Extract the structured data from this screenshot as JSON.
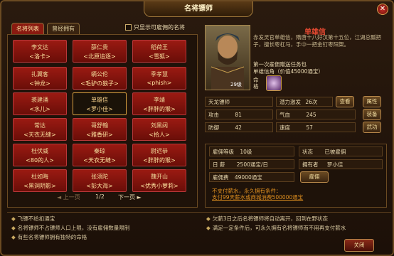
{
  "title": "名将镖师",
  "tabs": [
    "名将列表",
    "曾经拥有"
  ],
  "checkbox_label": "只显示可雇佣的名将",
  "generals": [
    {
      "n1": "李文达",
      "n2": "<洛卡>"
    },
    {
      "n1": "薛仁贵",
      "n2": "<北原追逐>"
    },
    {
      "n1": "稻荷王",
      "n2": "<雪狐>"
    },
    {
      "n1": "扎翼客",
      "n2": "<钟龙>"
    },
    {
      "n1": "辆公伦",
      "n2": "<毛驴の狼子>"
    },
    {
      "n1": "季孝慧",
      "n2": "<phish>"
    },
    {
      "n1": "裘建涌",
      "n2": "<水儿>"
    },
    {
      "n1": "单雄信",
      "n2": "<罗小佳>"
    },
    {
      "n1": "李靖",
      "n2": "<胖胖的猴>"
    },
    {
      "n1": "常达",
      "n2": "<天衣无缝>"
    },
    {
      "n1": "哥舒翰",
      "n2": "<雅香研>"
    },
    {
      "n1": "刘黑闼",
      "n2": "<拾人>"
    },
    {
      "n1": "杜伏威",
      "n2": "<80的人>"
    },
    {
      "n1": "秦琼",
      "n2": "<天衣无缝>"
    },
    {
      "n1": "尉迟恭",
      "n2": "<胖胖的猴>"
    },
    {
      "n1": "杜如晦",
      "n2": "<黑洞阴影>"
    },
    {
      "n1": "张须陀",
      "n2": "<彭大海>"
    },
    {
      "n1": "魏开山",
      "n2": "<优秀小萝莉>"
    }
  ],
  "pager": {
    "prev": "上一页",
    "page": "1/2",
    "next": "下一页"
  },
  "detail": {
    "name": "单雄信",
    "level": "29级",
    "desc": "赤发灵官单雄信，隋唐十八好汉第十五位，江湖总瓢把子，擅长枣杠马，手中一把金钉枣阳槊。",
    "pkg_line1": "第一次雇佣赠送任务包",
    "pkg_line2": "单雄信角（价值45000通宝）",
    "mingge": "命格"
  },
  "stats": {
    "escort": "天龙镖师",
    "potential_label": "潜力激发",
    "potential_val": "26次",
    "attack_label": "攻击",
    "attack_val": "81",
    "qi_label": "气血",
    "qi_val": "245",
    "defense_label": "防御",
    "defense_val": "42",
    "speed_label": "速度",
    "speed_val": "57",
    "btn_view": "查看",
    "btn_attr": "属性",
    "btn_equip": "装备",
    "btn_skill": "武功"
  },
  "info": {
    "level_label": "雇佣等级",
    "level_val": "10级",
    "state_label": "状态",
    "state_val": "已被雇佣",
    "daily_label": "日 薪",
    "daily_val": "2500通宝/日",
    "owner_label": "拥有者",
    "owner_val": "罗小佳",
    "fee_label": "雇佣费",
    "fee_val": "49000通宝",
    "hire_btn": "雇佣",
    "warn1": "不支付薪水，永久拥有条件：",
    "warn2": "支付99天薪水或商城消费500000通宝"
  },
  "notes_left": [
    "飞镖不给扣通宝",
    "名将镖师不占镖师人口上限，没有雇佣数量限制",
    "有些名将镖师拥有独特的命格"
  ],
  "notes_right": [
    "欠薪3日之后名将镖师将自动离开，回到在野状态",
    "满足一定条件后，可永久拥有名将镖师而不用再支付薪水"
  ],
  "close_btn": "关闭"
}
